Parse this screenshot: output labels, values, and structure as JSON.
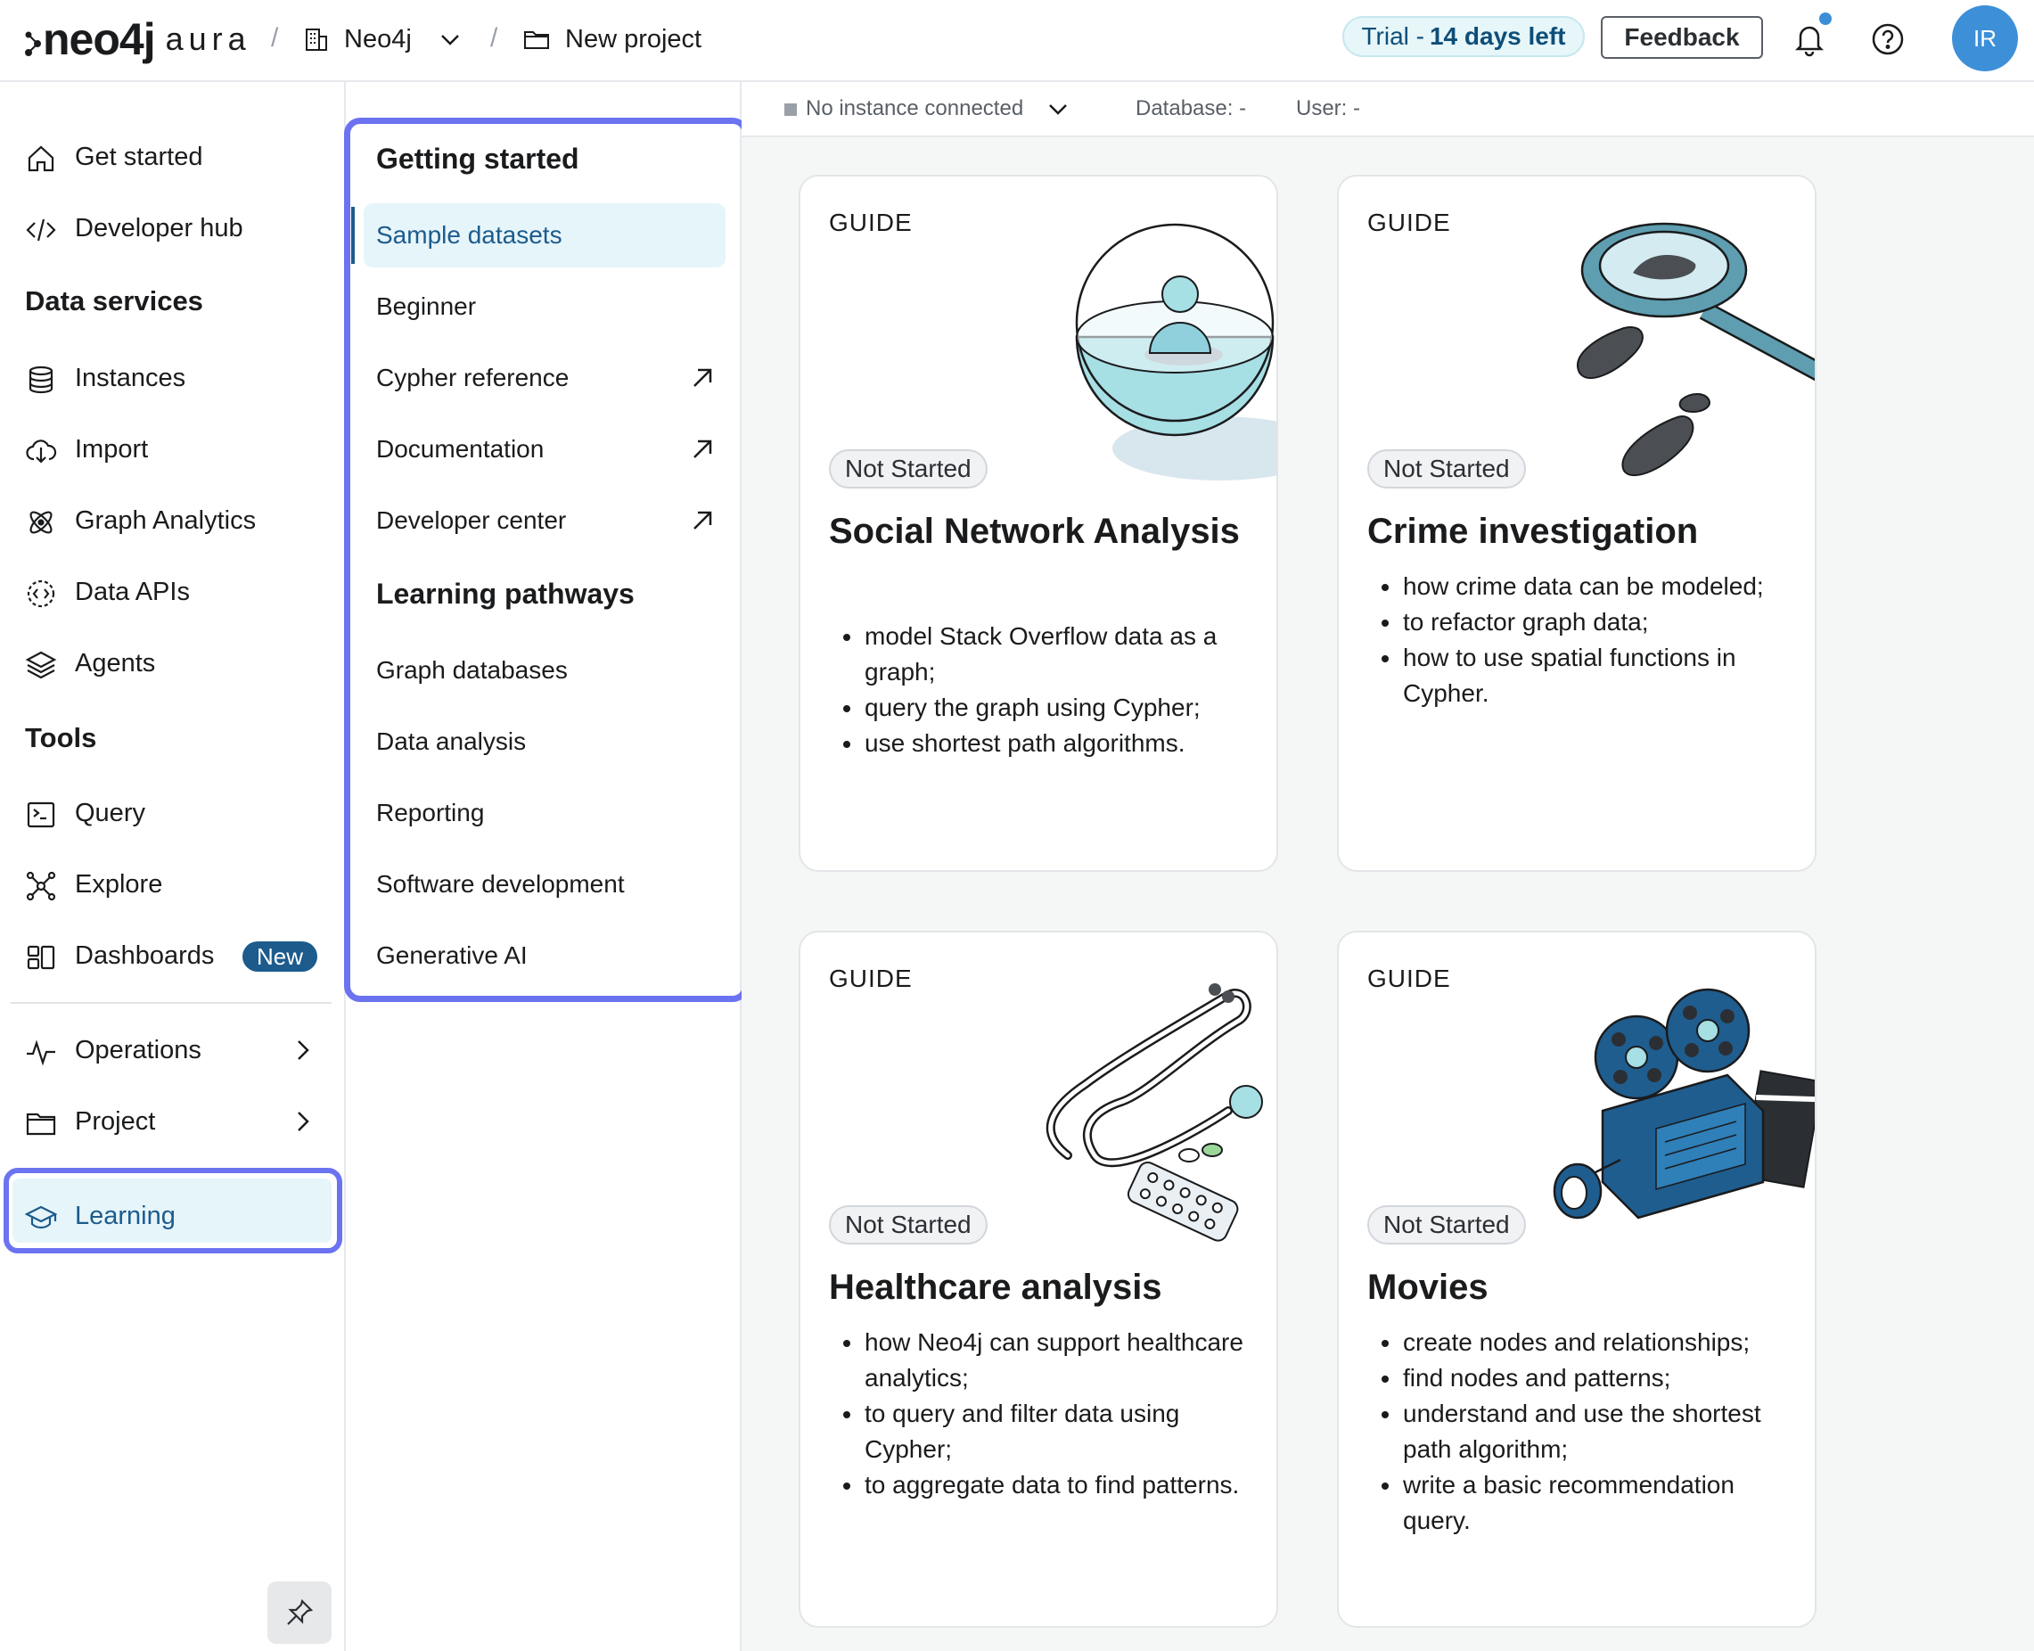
{
  "topbar": {
    "logo_text": "neo4j",
    "logo_sub": "aura",
    "sep": "/",
    "org": "Neo4j",
    "project": "New project",
    "trial_prefix": "Trial -",
    "trial_days": "14 days left",
    "feedback": "Feedback",
    "avatar": "IR"
  },
  "leftnav": {
    "items_top": [
      {
        "label": "Get started",
        "icon": "home-icon"
      },
      {
        "label": "Developer hub",
        "icon": "code-icon"
      }
    ],
    "data_services_heading": "Data services",
    "data_services": [
      {
        "label": "Instances",
        "icon": "database-icon"
      },
      {
        "label": "Import",
        "icon": "cloud-import-icon"
      },
      {
        "label": "Graph Analytics",
        "icon": "atom-icon"
      },
      {
        "label": "Data APIs",
        "icon": "api-icon"
      },
      {
        "label": "Agents",
        "icon": "layers-icon"
      }
    ],
    "tools_heading": "Tools",
    "tools": [
      {
        "label": "Query",
        "icon": "terminal-icon"
      },
      {
        "label": "Explore",
        "icon": "graph-icon"
      },
      {
        "label": "Dashboards",
        "icon": "dashboard-icon",
        "badge": "New"
      }
    ],
    "operations": "Operations",
    "project": "Project",
    "learning": "Learning"
  },
  "subnav": {
    "getting_started_heading": "Getting started",
    "getting_started": [
      {
        "label": "Sample datasets",
        "active": true
      },
      {
        "label": "Beginner"
      },
      {
        "label": "Cypher reference",
        "external": true
      },
      {
        "label": "Documentation",
        "external": true
      },
      {
        "label": "Developer center",
        "external": true
      }
    ],
    "pathways_heading": "Learning pathways",
    "pathways": [
      {
        "label": "Graph databases"
      },
      {
        "label": "Data analysis"
      },
      {
        "label": "Reporting"
      },
      {
        "label": "Software development"
      },
      {
        "label": "Generative AI"
      }
    ]
  },
  "connection": {
    "status": "No instance connected",
    "database": "Database: -",
    "user": "User: -"
  },
  "cards": [
    {
      "kind": "GUIDE",
      "status": "Not Started",
      "title": "Social Network Analysis",
      "bullets": [
        "model Stack Overflow data as a graph;",
        "query the graph using Cypher;",
        "use shortest path algorithms."
      ]
    },
    {
      "kind": "GUIDE",
      "status": "Not Started",
      "title": "Crime investigation",
      "bullets": [
        "how crime data can be modeled;",
        "to refactor graph data;",
        "how to use spatial functions in Cypher."
      ]
    },
    {
      "kind": "GUIDE",
      "status": "Not Started",
      "title": "Healthcare analysis",
      "bullets": [
        "how Neo4j can support healthcare analytics;",
        "to query and filter data using Cypher;",
        "to aggregate data to find patterns."
      ]
    },
    {
      "kind": "GUIDE",
      "status": "Not Started",
      "title": "Movies",
      "bullets": [
        "create nodes and relationships;",
        "find nodes and patterns;",
        "understand and use the shortest path algorithm;",
        "write a basic recommendation query."
      ]
    }
  ],
  "colors": {
    "accent": "#6b73f1",
    "active_bg": "#e6f5fa",
    "brand_blue": "#1c5b8c"
  }
}
